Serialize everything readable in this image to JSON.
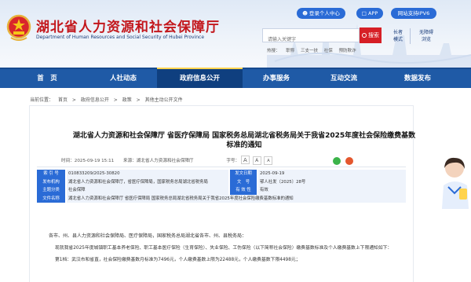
{
  "site": {
    "title": "湖北省人力资源和社会保障厅",
    "subtitle": "Department of Human Resources and Social Security of Hubei Province"
  },
  "topbar": {
    "login": "登录个人中心",
    "app": "APP",
    "ipv6": "网站支持IPV6"
  },
  "search": {
    "placeholder": "请输入关键字",
    "button": "搜索",
    "hot_label": "热搜：",
    "hot_terms": [
      "职称",
      "三支一扶",
      "社保",
      "预防欺诈"
    ]
  },
  "modes": {
    "elder_line1": "长者",
    "elder_line2": "模式",
    "barrier_line1": "无障碍",
    "barrier_line2": "浏览"
  },
  "nav": {
    "items": [
      "首　页",
      "人社动态",
      "政府信息公开",
      "办事服务",
      "互动交流",
      "数据发布"
    ]
  },
  "breadcrumb": {
    "prefix": "当前位置：",
    "items": [
      "首页",
      "政府信息公开",
      "政策",
      "其他主动公开文件"
    ],
    "sep": ">"
  },
  "doc": {
    "title_line1": "湖北省人力资源和社会保障厅 省医疗保障局 国家税务总局湖北省税务局关于我省2025年度社会保险缴费基数",
    "title_line2": "标准的通知",
    "time_label": "时间：",
    "time_value": "2025-09-19 15:11",
    "source_label": "来源：",
    "source_value": "湖北省人力资源和社会保障厅",
    "fontsize_label": "字号：",
    "font_large": "A",
    "font_medium": "A",
    "font_small": "A"
  },
  "info": {
    "rows": [
      {
        "l1": "索 引 号",
        "v1": "010833209/2025-30820",
        "l2": "发文日期",
        "v2": "2025-09-19"
      },
      {
        "l1": "发布机构",
        "v1": "湖北省人力资源和社会保障厅，省医疗保障局，国家税务总局湖北省税务局",
        "l2": "文　号",
        "v2": "鄂人社发〔2025〕28号"
      },
      {
        "l1": "主题分类",
        "v1": "社会保障",
        "l2": "有 效 性",
        "v2": "有效"
      },
      {
        "l1": "文件名称",
        "v1": "湖北省人力资源和社会保障厅 省医疗保障局 国家税务总局湖北省税务局关于我省2025年度社会保险缴费基数标准的通知",
        "l2": "",
        "v2": ""
      }
    ]
  },
  "body": {
    "p1": "各市、州、县人力资源和社会保障局、医疗保障局，国家税务总局湖北省各市、州、县税务局：",
    "p2": "现就我省2025年度城镇职工基本养老保险、职工基本医疗保险（生育保险）、失业保险、工伤保险（以下简称社会保险）缴费基数标准及个人缴费基数上下限通知如下：",
    "p3": "第1档：武汉市和省直，社会保险缴费基数月标准为7496元，个人缴费基数上限为22488元，个人缴费基数下限4498元；"
  },
  "colors": {
    "brand_red": "#c3171c",
    "nav_blue": "#1f5aa6",
    "accent_blue": "#2a6bd6"
  }
}
